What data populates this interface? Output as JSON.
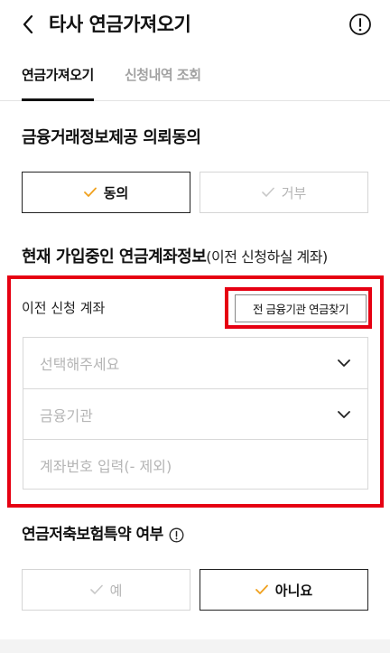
{
  "header": {
    "title": "타사 연금가져오기"
  },
  "tabs": [
    {
      "label": "연금가져오기",
      "active": true
    },
    {
      "label": "신청내역 조회",
      "active": false
    }
  ],
  "consent": {
    "title": "금융거래정보제공 의뢰동의",
    "agree_label": "동의",
    "decline_label": "거부",
    "selected": "agree"
  },
  "account_info": {
    "title": "현재 가입중인 연금계좌정보",
    "subtitle": "(이전 신청하실 계좌)",
    "prev_account_label": "이전 신청 계좌",
    "find_button_label": "전 금융기관 연금찾기",
    "account_select_placeholder": "선택해주세요",
    "institution_select_placeholder": "금융기관",
    "account_number_placeholder": "계좌번호 입력(- 제외)"
  },
  "annuity": {
    "title": "연금저축보험특약 여부",
    "yes_label": "예",
    "no_label": "아니요",
    "selected": "no"
  },
  "colors": {
    "accent_check": "#f0a11e",
    "highlight_red": "#e60012",
    "inactive_text": "#a3a3a3"
  }
}
